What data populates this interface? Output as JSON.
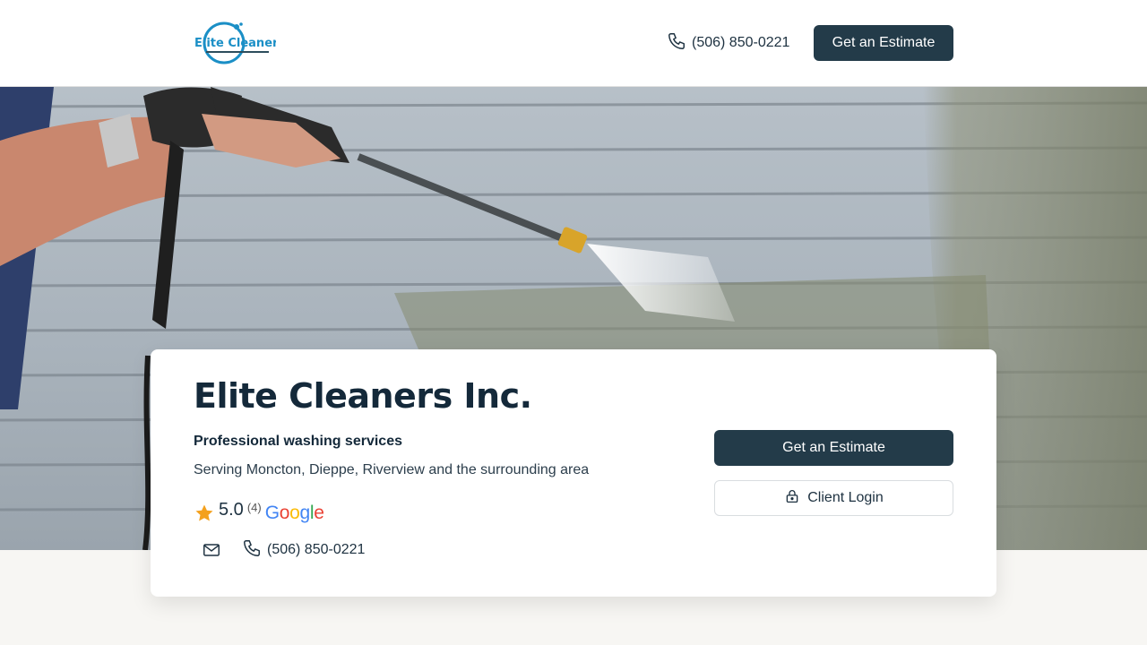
{
  "header": {
    "logo_text": "Elite Cleaners",
    "phone": "(506) 850-0221",
    "cta_label": "Get an Estimate"
  },
  "hero": {
    "image": "pressure-washer-cleaning-siding"
  },
  "card": {
    "title": "Elite Cleaners Inc.",
    "tagline": "Professional washing services",
    "service_area": "Serving Moncton, Dieppe, Riverview and the surrounding area",
    "rating": {
      "value": "5.0",
      "count": "(4)",
      "source": "Google"
    },
    "phone": "(506) 850-0221",
    "cta_label": "Get an Estimate",
    "login_label": "Client Login"
  },
  "colors": {
    "primary": "#233b49",
    "title": "#14293a",
    "star": "#f4a11d",
    "background": "#f7f6f3"
  },
  "icons": [
    "phone-icon",
    "star-icon",
    "mail-icon",
    "lock-icon"
  ]
}
